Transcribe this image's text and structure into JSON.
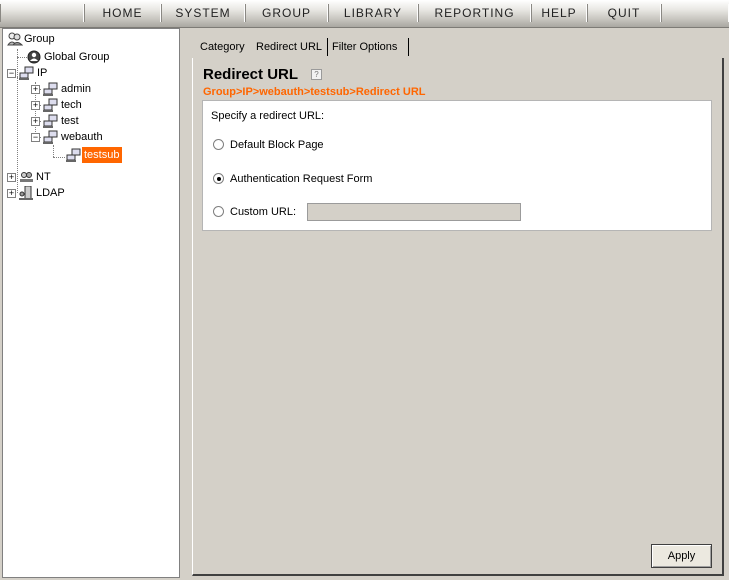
{
  "menu": {
    "items": [
      {
        "label": "HOME"
      },
      {
        "label": "SYSTEM"
      },
      {
        "label": "GROUP"
      },
      {
        "label": "LIBRARY"
      },
      {
        "label": "REPORTING"
      },
      {
        "label": "HELP"
      },
      {
        "label": "QUIT"
      }
    ]
  },
  "tree": {
    "root": "Group",
    "global_group": "Global Group",
    "ip": "IP",
    "admin": "admin",
    "tech": "tech",
    "test": "test",
    "webauth": "webauth",
    "testsub": "testsub",
    "nt": "NT",
    "ldap": "LDAP"
  },
  "tabs": [
    {
      "label": "Category"
    },
    {
      "label": "Redirect URL"
    },
    {
      "label": "Filter Options"
    }
  ],
  "page": {
    "title": "Redirect URL",
    "help_icon": "?",
    "breadcrumb": "Group>IP>webauth>testsub>Redirect URL",
    "prompt": "Specify a redirect URL:"
  },
  "options": {
    "default_block": {
      "label": "Default Block Page",
      "checked": false
    },
    "auth_form": {
      "label": "Authentication Request Form",
      "checked": true
    },
    "custom_url": {
      "label": "Custom URL:",
      "checked": false,
      "value": ""
    }
  },
  "actions": {
    "apply": "Apply"
  },
  "colors": {
    "accent": "#ff6600",
    "selected_bg": "#ff6600"
  }
}
